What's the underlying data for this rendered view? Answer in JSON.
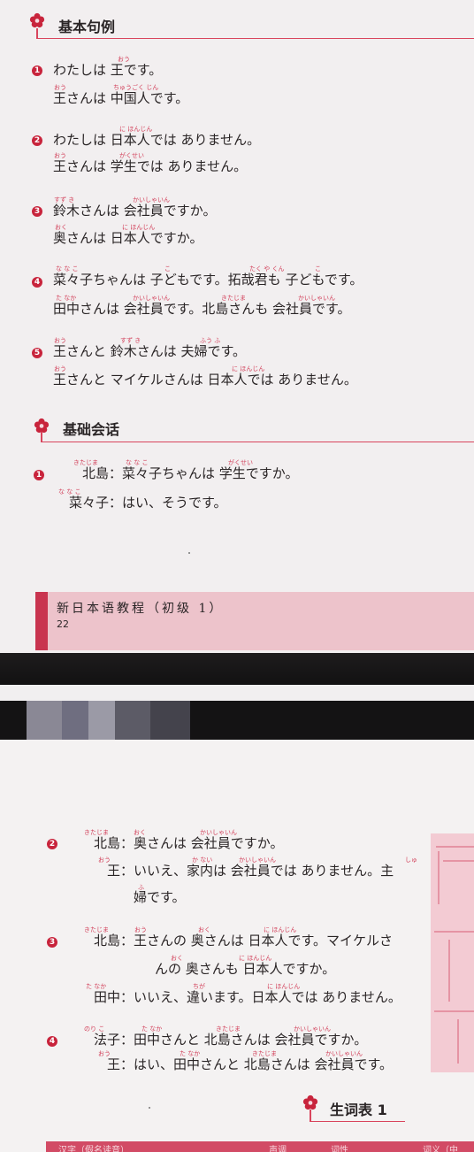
{
  "top_page": {
    "section1": {
      "title": "基本句例"
    },
    "sentences": [
      {
        "num": "1",
        "lines": [
          "わたしは 王です。",
          "王さんは 中国人です。"
        ]
      },
      {
        "num": "2",
        "lines": [
          "わたしは 日本人では ありません。",
          "王さんは 学生では ありません。"
        ]
      },
      {
        "num": "3",
        "lines": [
          "鈴木さんは 会社員ですか。",
          "奥さんは 日本人ですか。"
        ]
      },
      {
        "num": "4",
        "lines": [
          "菜々子ちゃんは 子どもです。拓哉君も 子どもです。",
          "田中さんは 会社員です。北島さんも 会社員です。"
        ]
      },
      {
        "num": "5",
        "lines": [
          "王さんと 鈴木さんは 夫婦です。",
          "王さんと マイケルさんは 日本人では ありません。"
        ]
      }
    ],
    "section2": {
      "title": "基础会话"
    },
    "dialogue1": {
      "num": "1",
      "lines": [
        {
          "speaker": "北島：",
          "text": "菜々子ちゃんは 学生ですか。"
        },
        {
          "speaker": "菜々子：",
          "text": "はい、そうです。"
        }
      ]
    },
    "footer": {
      "book_title": "新日本语教程（初级 1）",
      "page": "22"
    }
  },
  "furigana": {
    "s1a": "おう",
    "s1b1": "おう",
    "s1b2": "ちゅうごく じん",
    "s2a": "に ほんじん",
    "s2b1": "おう",
    "s2b2": "がくせい",
    "s3a1": "すず き",
    "s3a2": "かいしゃいん",
    "s3b1": "おく",
    "s3b2": "に ほんじん",
    "s4a1": "な な こ",
    "s4a2": "こ",
    "s4a3": "たく や くん",
    "s4a4": "こ",
    "s4b1": "た なか",
    "s4b2": "かいしゃいん",
    "s4b3": "きたじま",
    "s4b4": "かいしゃいん",
    "s5a1": "おう",
    "s5a2": "すず き",
    "s5a3": "ふう ふ",
    "s5b1": "おう",
    "s5b2": "に ほんじん",
    "d1a1": "きたじま",
    "d1a2": "な な こ",
    "d1a3": "がくせい",
    "d1b1": "な な こ",
    "d2a1": "きたじま",
    "d2a2": "おく",
    "d2a3": "かいしゃいん",
    "d2b1": "おう",
    "d2b2": "か ない",
    "d2b3": "かいしゃいん",
    "d2b4": "しゅ",
    "d2c1": "ふ",
    "d3a1": "きたじま",
    "d3a2": "おう",
    "d3a3": "おく",
    "d3a4": "に ほんじん",
    "d3b1": "おく",
    "d3b2": "に ほんじん",
    "d3c1": "た なか",
    "d3c2": "ちが",
    "d3c3": "に ほんじん",
    "d4a1": "のり こ",
    "d4a2": "た なか",
    "d4a3": "きたじま",
    "d4a4": "かいしゃいん",
    "d4b1": "おう",
    "d4b2": "た なか",
    "d4b3": "きたじま",
    "d4b4": "かいしゃいん"
  },
  "bottom_page": {
    "dialogues": [
      {
        "num": "2",
        "lines": [
          {
            "speaker": "北島：",
            "text": "奥さんは 会社員ですか。"
          },
          {
            "speaker": "王：",
            "text": "いいえ、家内は 会社員では ありません。主"
          },
          {
            "speaker": "",
            "text": "婦です。"
          }
        ]
      },
      {
        "num": "3",
        "lines": [
          {
            "speaker": "北島：",
            "text": "王さんの 奥さんは 日本人です。マイケルさ"
          },
          {
            "speaker": "",
            "text": "んの 奥さんも 日本人ですか。"
          },
          {
            "speaker": "田中：",
            "text": "いいえ、違います。日本人では ありません。"
          }
        ]
      },
      {
        "num": "4",
        "lines": [
          {
            "speaker": "法子：",
            "text": "田中さんと 北島さんは 会社員ですか。"
          },
          {
            "speaker": "王：",
            "text": "はい、田中さんと 北島さんは 会社員です。"
          }
        ]
      }
    ],
    "section3": {
      "title": "生词表 1"
    },
    "vocab_header": [
      "汉字（假名读音）",
      "声调",
      "词性",
      "词义（中"
    ]
  },
  "colors": {
    "accent": "#c8243c",
    "furigana": "#d2405a",
    "footer_bg": "#edc3cb"
  },
  "icons": {
    "section_marker": "flower-icon"
  }
}
